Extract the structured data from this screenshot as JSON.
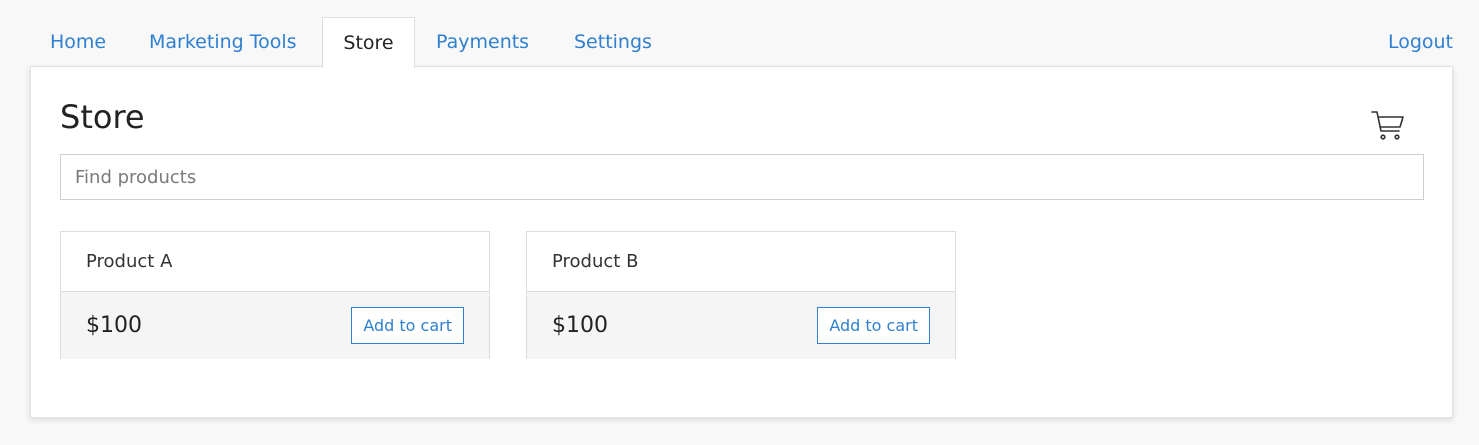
{
  "nav": {
    "tabs": [
      {
        "label": "Home"
      },
      {
        "label": "Marketing Tools"
      },
      {
        "label": "Store",
        "active": true
      },
      {
        "label": "Payments"
      },
      {
        "label": "Settings"
      }
    ],
    "logout_label": "Logout"
  },
  "main": {
    "title": "Store",
    "cart_icon": "cart-icon",
    "search": {
      "placeholder": "Find products",
      "value": ""
    },
    "products": [
      {
        "name": "Product A",
        "price": "$100",
        "button_label": "Add to cart"
      },
      {
        "name": "Product B",
        "price": "$100",
        "button_label": "Add to cart"
      }
    ]
  },
  "colors": {
    "link": "#2f80d0",
    "background": "#f8f8f8",
    "panel": "#ffffff",
    "card_footer": "#f5f5f5"
  }
}
